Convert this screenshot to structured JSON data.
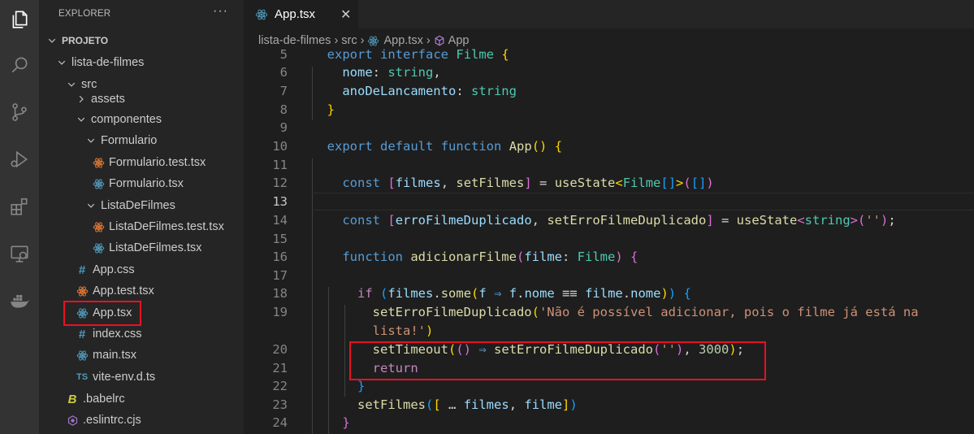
{
  "activity_bar": {
    "items": [
      {
        "name": "explorer-icon"
      },
      {
        "name": "search-icon"
      },
      {
        "name": "source-control-icon"
      },
      {
        "name": "run-debug-icon"
      },
      {
        "name": "extensions-icon"
      },
      {
        "name": "remote-explorer-icon"
      },
      {
        "name": "docker-icon"
      }
    ]
  },
  "sidebar": {
    "title": "EXPLORER",
    "more_actions": "···",
    "tree": [
      {
        "label": "PROJETO",
        "type": "root",
        "expanded": true
      },
      {
        "label": "lista-de-filmes",
        "type": "folder",
        "expanded": true
      },
      {
        "label": "src",
        "type": "folder",
        "expanded": true
      },
      {
        "label": "assets",
        "type": "folder",
        "expanded": false
      },
      {
        "label": "componentes",
        "type": "folder",
        "expanded": true
      },
      {
        "label": "Formulario",
        "type": "folder",
        "expanded": true
      },
      {
        "label": "Formulario.test.tsx",
        "type": "react-test"
      },
      {
        "label": "Formulario.tsx",
        "type": "react"
      },
      {
        "label": "ListaDeFilmes",
        "type": "folder",
        "expanded": true
      },
      {
        "label": "ListaDeFilmes.test.tsx",
        "type": "react-test"
      },
      {
        "label": "ListaDeFilmes.tsx",
        "type": "react"
      },
      {
        "label": "App.css",
        "type": "css"
      },
      {
        "label": "App.test.tsx",
        "type": "react-test"
      },
      {
        "label": "App.tsx",
        "type": "react",
        "selected": true
      },
      {
        "label": "index.css",
        "type": "css"
      },
      {
        "label": "main.tsx",
        "type": "react"
      },
      {
        "label": "vite-env.d.ts",
        "type": "ts",
        "icon_text": "TS"
      },
      {
        "label": ".babelrc",
        "type": "babel",
        "icon_text": "B"
      },
      {
        "label": ".eslintrc.cjs",
        "type": "eslint"
      }
    ]
  },
  "tab": {
    "label": "App.tsx",
    "close": "✕"
  },
  "breadcrumb": [
    "lista-de-filmes",
    "src",
    "App.tsx",
    "App"
  ],
  "editor": {
    "current_line": "13",
    "lines": [
      {
        "n": "5",
        "t": [
          [
            "  ",
            "p"
          ],
          [
            "export",
            "kw"
          ],
          [
            " ",
            "p"
          ],
          [
            "interface",
            "kw"
          ],
          [
            " ",
            "p"
          ],
          [
            "Filme",
            "ty"
          ],
          [
            " ",
            "p"
          ],
          [
            "{",
            "b1"
          ]
        ]
      },
      {
        "n": "6",
        "t": [
          [
            "    ",
            "p"
          ],
          [
            "nome",
            "pr"
          ],
          [
            ": ",
            "p"
          ],
          [
            "string",
            "ty"
          ],
          [
            ",",
            "p"
          ]
        ]
      },
      {
        "n": "7",
        "t": [
          [
            "    ",
            "p"
          ],
          [
            "anoDeLancamento",
            "pr"
          ],
          [
            ": ",
            "p"
          ],
          [
            "string",
            "ty"
          ]
        ]
      },
      {
        "n": "8",
        "t": [
          [
            "  ",
            "p"
          ],
          [
            "}",
            "b1"
          ]
        ]
      },
      {
        "n": "9",
        "t": []
      },
      {
        "n": "10",
        "t": [
          [
            "  ",
            "p"
          ],
          [
            "export",
            "kw"
          ],
          [
            " ",
            "p"
          ],
          [
            "default",
            "kw"
          ],
          [
            " ",
            "p"
          ],
          [
            "function",
            "kw"
          ],
          [
            " ",
            "p"
          ],
          [
            "App",
            "fn"
          ],
          [
            "()",
            "b1"
          ],
          [
            " ",
            "p"
          ],
          [
            "{",
            "b1"
          ]
        ]
      },
      {
        "n": "11",
        "t": []
      },
      {
        "n": "12",
        "t": [
          [
            "    ",
            "p"
          ],
          [
            "const",
            "kw"
          ],
          [
            " ",
            "p"
          ],
          [
            "[",
            "b2"
          ],
          [
            "filmes",
            "pr"
          ],
          [
            ", ",
            "p"
          ],
          [
            "setFilmes",
            "fn"
          ],
          [
            "]",
            "b2"
          ],
          [
            " = ",
            "p"
          ],
          [
            "useState",
            "fn"
          ],
          [
            "<",
            "b1"
          ],
          [
            "Filme",
            "ty"
          ],
          [
            "[]",
            "b3"
          ],
          [
            ">",
            "b1"
          ],
          [
            "(",
            "b2"
          ],
          [
            "[]",
            "b3"
          ],
          [
            ")",
            "b2"
          ]
        ]
      },
      {
        "n": "13",
        "t": []
      },
      {
        "n": "14",
        "t": [
          [
            "    ",
            "p"
          ],
          [
            "const",
            "kw"
          ],
          [
            " ",
            "p"
          ],
          [
            "[",
            "b2"
          ],
          [
            "erroFilmeDuplicado",
            "pr"
          ],
          [
            ", ",
            "p"
          ],
          [
            "setErroFilmeDuplicado",
            "fn"
          ],
          [
            "]",
            "b2"
          ],
          [
            " = ",
            "p"
          ],
          [
            "useState",
            "fn"
          ],
          [
            "<",
            "b2"
          ],
          [
            "string",
            "ty"
          ],
          [
            ">",
            "b2"
          ],
          [
            "(",
            "b2"
          ],
          [
            "''",
            "str"
          ],
          [
            ")",
            "b2"
          ],
          [
            ";",
            "p"
          ]
        ]
      },
      {
        "n": "15",
        "t": []
      },
      {
        "n": "16",
        "t": [
          [
            "    ",
            "p"
          ],
          [
            "function",
            "kw"
          ],
          [
            " ",
            "p"
          ],
          [
            "adicionarFilme",
            "fn"
          ],
          [
            "(",
            "b2"
          ],
          [
            "filme",
            "pr"
          ],
          [
            ": ",
            "p"
          ],
          [
            "Filme",
            "ty"
          ],
          [
            ")",
            "b2"
          ],
          [
            " ",
            "p"
          ],
          [
            "{",
            "b2"
          ]
        ]
      },
      {
        "n": "17",
        "t": []
      },
      {
        "n": "18",
        "t": [
          [
            "      ",
            "p"
          ],
          [
            "if",
            "ctl"
          ],
          [
            " ",
            "p"
          ],
          [
            "(",
            "b3"
          ],
          [
            "filmes",
            "pr"
          ],
          [
            ".",
            "p"
          ],
          [
            "some",
            "fn"
          ],
          [
            "(",
            "b1"
          ],
          [
            "f",
            "pr"
          ],
          [
            " ",
            "p"
          ],
          [
            "⇒",
            "kw"
          ],
          [
            " ",
            "p"
          ],
          [
            "f",
            "pr"
          ],
          [
            ".",
            "p"
          ],
          [
            "nome",
            "pr"
          ],
          [
            " ≡≡ ",
            "p"
          ],
          [
            "filme",
            "pr"
          ],
          [
            ".",
            "p"
          ],
          [
            "nome",
            "pr"
          ],
          [
            ")",
            "b1"
          ],
          [
            ")",
            "b3"
          ],
          [
            " ",
            "p"
          ],
          [
            "{",
            "b3"
          ]
        ]
      },
      {
        "n": "19",
        "t": [
          [
            "        ",
            "p"
          ],
          [
            "setErroFilmeDuplicado",
            "fn"
          ],
          [
            "(",
            "b1"
          ],
          [
            "'Não é possível adicionar, pois o filme já está na",
            "str"
          ]
        ]
      },
      {
        "n": "",
        "t": [
          [
            "        ",
            "p"
          ],
          [
            "lista!'",
            "str"
          ],
          [
            ")",
            "b1"
          ]
        ]
      },
      {
        "n": "20",
        "t": [
          [
            "        ",
            "p"
          ],
          [
            "setTimeout",
            "fn"
          ],
          [
            "(",
            "b1"
          ],
          [
            "()",
            "b2"
          ],
          [
            " ",
            "p"
          ],
          [
            "⇒",
            "kw"
          ],
          [
            " ",
            "p"
          ],
          [
            "setErroFilmeDuplicado",
            "fn"
          ],
          [
            "(",
            "b2"
          ],
          [
            "''",
            "str"
          ],
          [
            ")",
            "b2"
          ],
          [
            ", ",
            "p"
          ],
          [
            "3000",
            "num"
          ],
          [
            ")",
            "b1"
          ],
          [
            ";",
            "p"
          ]
        ]
      },
      {
        "n": "21",
        "t": [
          [
            "        ",
            "p"
          ],
          [
            "return",
            "ctl"
          ]
        ]
      },
      {
        "n": "22",
        "t": [
          [
            "      ",
            "p"
          ],
          [
            "}",
            "b3"
          ]
        ]
      },
      {
        "n": "23",
        "t": [
          [
            "      ",
            "p"
          ],
          [
            "setFilmes",
            "fn"
          ],
          [
            "(",
            "b3"
          ],
          [
            "[",
            "b1"
          ],
          [
            " … ",
            "p"
          ],
          [
            "filmes",
            "pr"
          ],
          [
            ", ",
            "p"
          ],
          [
            "filme",
            "pr"
          ],
          [
            "]",
            "b1"
          ],
          [
            ")",
            "b3"
          ]
        ]
      },
      {
        "n": "24",
        "t": [
          [
            "    ",
            "p"
          ],
          [
            "}",
            "b2"
          ]
        ]
      }
    ]
  },
  "colors": {
    "activity_bar": "#333333",
    "sidebar": "#252526",
    "editor": "#1e1e1e",
    "highlight_box": "#e81123"
  }
}
